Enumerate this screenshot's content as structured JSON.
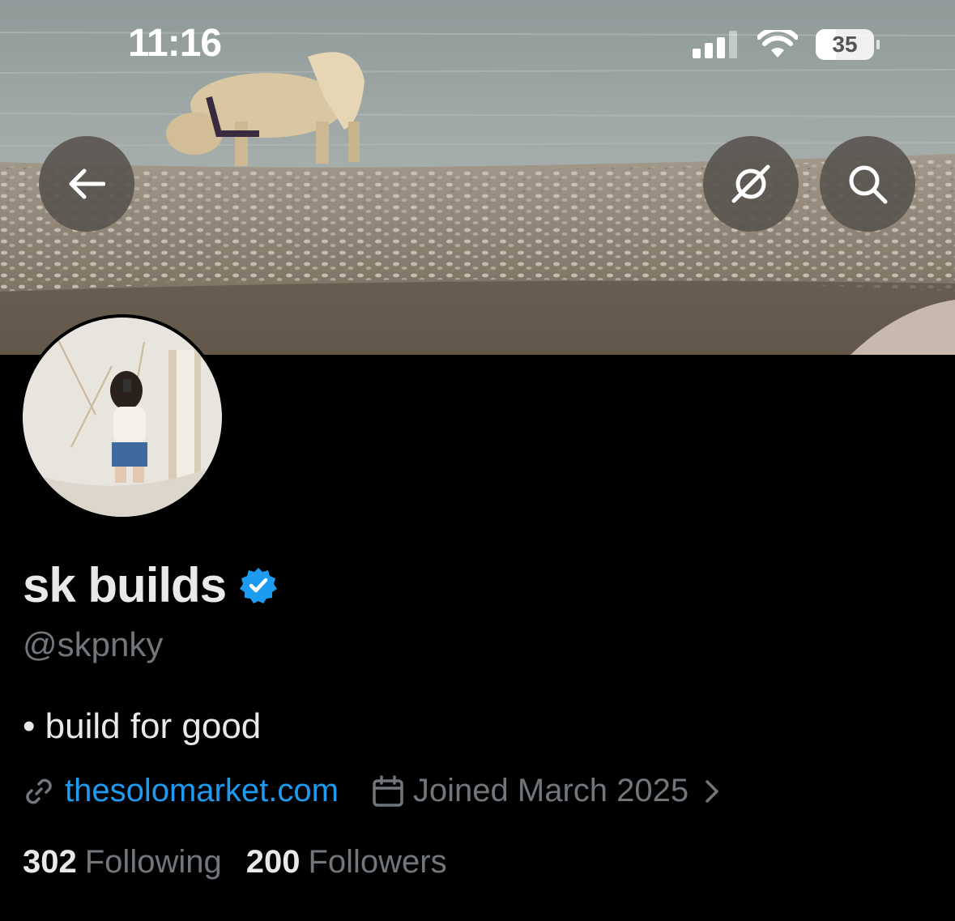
{
  "status_bar": {
    "time": "11:16",
    "battery": "35",
    "battery_level": 0.35
  },
  "header": {
    "back_icon": "arrow-left-icon",
    "grok_icon": "grok-icon",
    "search_icon": "search-icon"
  },
  "profile": {
    "name": "sk builds",
    "handle": "@skpnky",
    "verified_icon": "verified-badge-icon",
    "bio": "• build for good",
    "website": "thesolomarket.com",
    "joined": "Joined March 2025",
    "following_count": "302",
    "following_label": "Following",
    "followers_count": "200",
    "followers_label": "Followers"
  },
  "colors": {
    "accent": "#1d9bf0",
    "background": "#000000",
    "muted": "#71767b"
  }
}
